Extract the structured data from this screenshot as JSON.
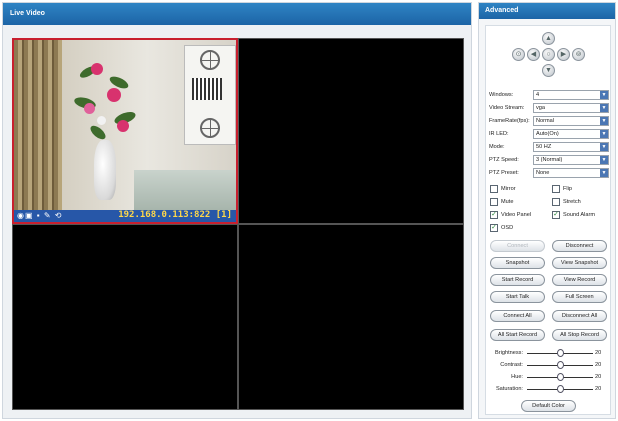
{
  "live": {
    "title": "Live Video"
  },
  "camera": {
    "status_icons": "◉▣ ▪ ✎ ⟲",
    "address": "192.168.0.113:822 [1]"
  },
  "advanced": {
    "title": "Advanced",
    "settings": [
      {
        "label": "Windows:",
        "value": "4"
      },
      {
        "label": "Video Stream:",
        "value": "vga"
      },
      {
        "label": "FrameRate(fps):",
        "value": "Normal"
      },
      {
        "label": "IR LED:",
        "value": "Auto(On)"
      },
      {
        "label": "Mode:",
        "value": "50 HZ"
      },
      {
        "label": "PTZ Speed:",
        "value": "3 (Normal)"
      },
      {
        "label": "PTZ Preset:",
        "value": "None"
      }
    ],
    "checkboxes": [
      {
        "label": "Mirror",
        "checked": false
      },
      {
        "label": "Flip",
        "checked": false
      },
      {
        "label": "Mute",
        "checked": false
      },
      {
        "label": "Stretch",
        "checked": false
      },
      {
        "label": "Video Panel",
        "checked": true
      },
      {
        "label": "Sound Alarm",
        "checked": true
      },
      {
        "label": "OSD",
        "checked": true
      }
    ],
    "buttons": [
      {
        "label": "Connect",
        "disabled": true
      },
      {
        "label": "Disconnect",
        "disabled": false
      },
      {
        "label": "Snapshot",
        "disabled": false
      },
      {
        "label": "View Snapshot",
        "disabled": false
      },
      {
        "label": "Start Record",
        "disabled": false
      },
      {
        "label": "View Record",
        "disabled": false
      },
      {
        "label": "Start Talk",
        "disabled": false
      },
      {
        "label": "Full Screen",
        "disabled": false
      },
      {
        "label": "Connect All",
        "disabled": false
      },
      {
        "label": "Disconnect All",
        "disabled": false
      },
      {
        "label": "All Start Record",
        "disabled": false
      },
      {
        "label": "All Stop Record",
        "disabled": false
      }
    ],
    "sliders": [
      {
        "label": "Brightness:",
        "value": "20",
        "level": 0.5
      },
      {
        "label": "Contrast:",
        "value": "20",
        "level": 0.5
      },
      {
        "label": "Hue:",
        "value": "20",
        "level": 0.5
      },
      {
        "label": "Saturation:",
        "value": "20",
        "level": 0.5
      }
    ],
    "default_color_label": "Default Color",
    "ptz_icons": {
      "up": "▲",
      "down": "▼",
      "left": "◀",
      "right": "▶",
      "center": "○",
      "home_left": "⊙",
      "home_right": "⊚"
    }
  }
}
